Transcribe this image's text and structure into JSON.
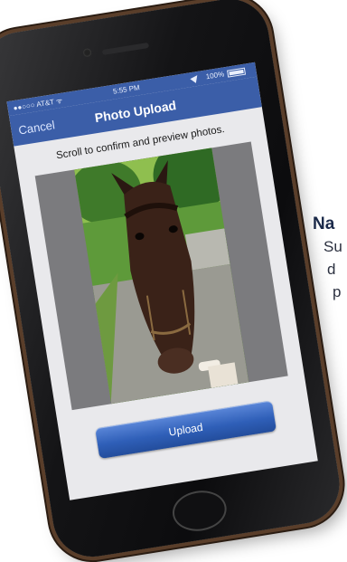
{
  "side_text": {
    "heading": "Na",
    "lines": [
      "Su",
      "d",
      "p"
    ]
  },
  "status_bar": {
    "carrier": "●●○○○ AT&T ᯤ",
    "time": "5:55 PM",
    "battery": "100%"
  },
  "nav_bar": {
    "cancel_label": "Cancel",
    "title": "Photo Upload"
  },
  "screen": {
    "instructions": "Scroll to confirm and preview photos.",
    "upload_label": "Upload"
  },
  "colors": {
    "nav_blue": "#3b5ea8",
    "button_blue": "#2f5fb8",
    "preview_gray": "#7b7b7e",
    "screen_bg": "#e9e9ec"
  }
}
